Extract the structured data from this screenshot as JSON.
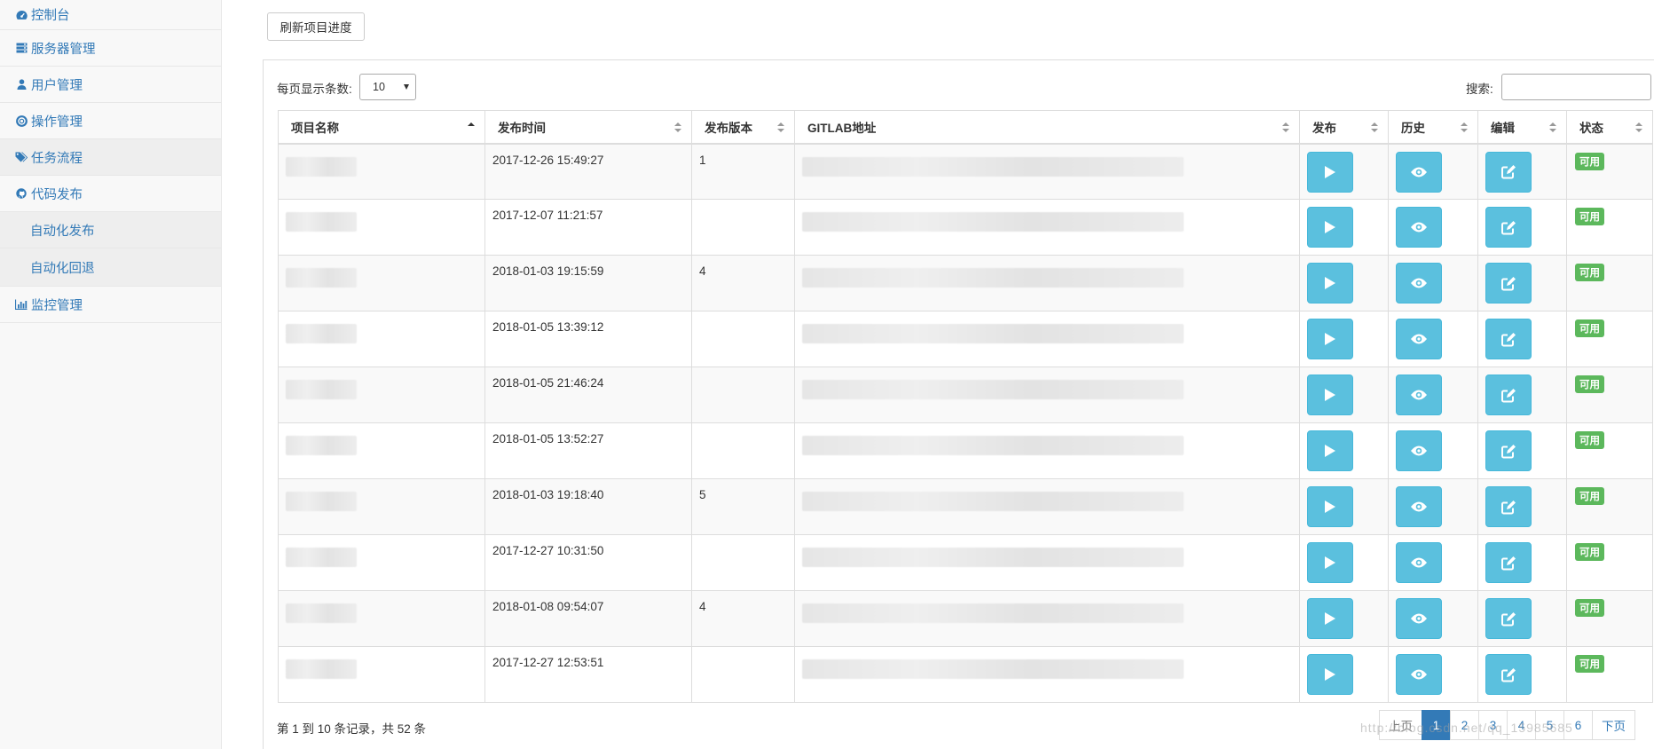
{
  "sidebar": {
    "items": [
      {
        "label": "控制台",
        "icon": "dashboard-icon"
      },
      {
        "label": "服务器管理",
        "icon": "server-icon"
      },
      {
        "label": "用户管理",
        "icon": "user-icon"
      },
      {
        "label": "操作管理",
        "icon": "lifebuoy-icon"
      },
      {
        "label": "任务流程",
        "icon": "tags-icon"
      },
      {
        "label": "代码发布",
        "icon": "github-icon"
      },
      {
        "label": "自动化发布",
        "icon": ""
      },
      {
        "label": "自动化回退",
        "icon": ""
      },
      {
        "label": "监控管理",
        "icon": "bar-chart-icon"
      }
    ]
  },
  "toolbar": {
    "refresh_label": "刷新项目进度"
  },
  "table_controls": {
    "length_label": "每页显示条数:",
    "length_value": "10",
    "search_label": "搜索:",
    "search_value": ""
  },
  "table": {
    "columns": [
      "项目名称",
      "发布时间",
      "发布版本",
      "GITLAB地址",
      "发布",
      "历史",
      "编辑",
      "状态"
    ],
    "rows": [
      {
        "name": "",
        "time": "2017-12-26 15:49:27",
        "version": "1",
        "gitlab": "",
        "status": "可用"
      },
      {
        "name": "",
        "time": "2017-12-07 11:21:57",
        "version": "",
        "gitlab": "",
        "status": "可用"
      },
      {
        "name": "",
        "time": "2018-01-03 19:15:59",
        "version": "4",
        "gitlab": "",
        "status": "可用"
      },
      {
        "name": "",
        "time": "2018-01-05 13:39:12",
        "version": "",
        "gitlab": "",
        "status": "可用"
      },
      {
        "name": "",
        "time": "2018-01-05 21:46:24",
        "version": "",
        "gitlab": "",
        "status": "可用"
      },
      {
        "name": "",
        "time": "2018-01-05 13:52:27",
        "version": "",
        "gitlab": "",
        "status": "可用"
      },
      {
        "name": "",
        "time": "2018-01-03 19:18:40",
        "version": "5",
        "gitlab": "",
        "status": "可用"
      },
      {
        "name": "",
        "time": "2017-12-27 10:31:50",
        "version": "",
        "gitlab": "",
        "status": "可用"
      },
      {
        "name": "",
        "time": "2018-01-08 09:54:07",
        "version": "4",
        "gitlab": "",
        "status": "可用"
      },
      {
        "name": "",
        "time": "2017-12-27 12:53:51",
        "version": "",
        "gitlab": "",
        "status": "可用"
      }
    ]
  },
  "footer": {
    "info": "第 1 到 10 条记录，共 52 条",
    "pagination": [
      "上页",
      "1",
      "2",
      "3",
      "4",
      "5",
      "6",
      "下页"
    ],
    "current_page": "1",
    "watermark": "http://blog.csdn.net/qq_15985685"
  },
  "colors": {
    "primary": "#337ab7",
    "info": "#5bc0de",
    "success": "#5cb85c"
  }
}
